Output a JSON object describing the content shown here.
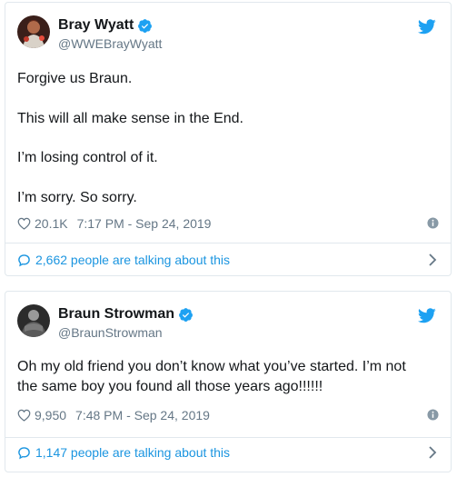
{
  "tweets": [
    {
      "name": "Bray Wyatt",
      "handle": "@WWEBrayWyatt",
      "lines": [
        "Forgive us Braun.",
        "This will all make sense in the End.",
        "I’m losing control of it.",
        "I’m sorry. So sorry."
      ],
      "likes": "20.1K",
      "timestamp": "7:17 PM - Sep 24, 2019",
      "talking": "2,662 people are talking about this"
    },
    {
      "name": "Braun Strowman",
      "handle": "@BraunStrowman",
      "text": "Oh my old friend you don’t know what you’ve started.  I’m not the same boy you found all those years ago!!!!!!",
      "likes": "9,950",
      "timestamp": "7:48 PM - Sep 24, 2019",
      "talking": "1,147 people are talking about this"
    }
  ],
  "colors": {
    "accent": "#1b95e0",
    "verified": "#1da1f2",
    "secondary_text": "#657786",
    "border": "#e1e8ed"
  },
  "icons": [
    "verified-badge-icon",
    "twitter-bird-icon",
    "heart-icon",
    "info-icon",
    "speech-bubble-icon",
    "chevron-right-icon"
  ]
}
